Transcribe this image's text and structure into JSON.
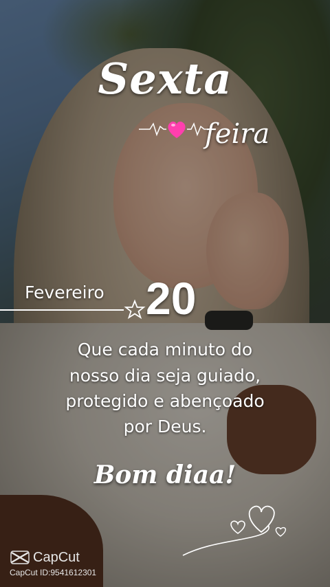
{
  "title": {
    "line1": "Sexta",
    "line2": "feira"
  },
  "date": {
    "month": "Fevereiro",
    "day": "20"
  },
  "message": {
    "lines": [
      "Que cada minuto do",
      "nosso dia seja guiado,",
      "protegido e abençoado",
      "por Deus."
    ]
  },
  "greeting": "Bom diaa!",
  "watermark": {
    "brand": "CapCut",
    "id_text": "CapCut ID:9541612301"
  },
  "icons": {
    "heartbeat": "heartbeat-heart-icon",
    "star": "star-outline-icon",
    "hearts": "hearts-swirl-icon",
    "logo": "capcut-logo-icon"
  },
  "colors": {
    "text": "#ffffff",
    "heart": "#ff3fae"
  }
}
